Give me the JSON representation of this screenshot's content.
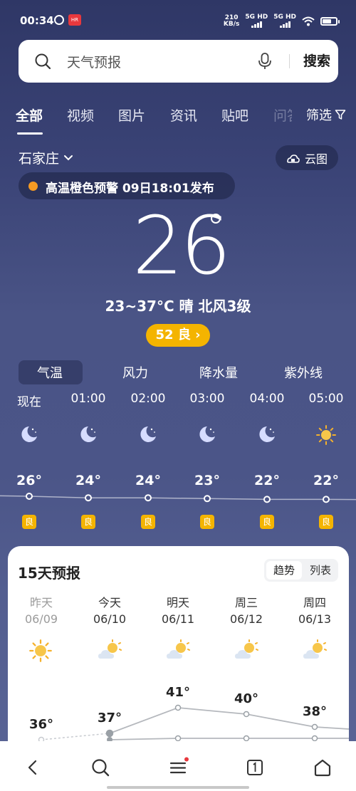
{
  "status_bar": {
    "time": "00:34",
    "app_badge": "HR",
    "net_speed_value": "210",
    "net_speed_unit": "KB/s",
    "sim1": "5G HD",
    "sim2": "5G HD"
  },
  "search": {
    "query": "天气预报",
    "button": "搜索"
  },
  "tabs": [
    "全部",
    "视频",
    "图片",
    "资讯",
    "贴吧",
    "问答"
  ],
  "filter": "筛选",
  "weather": {
    "city": "石家庄",
    "cloud_map": "云图",
    "alert": "高温橙色预警  09日18:01发布",
    "current_temp": "26",
    "description": "23~37°C 晴 北风3级",
    "aqi": "52 良 ›"
  },
  "metric_tabs": [
    "气温",
    "风力",
    "降水量",
    "紫外线"
  ],
  "hourly": [
    {
      "time": "现在",
      "icon": "moon-icon",
      "temp": "26°",
      "aqi": "良",
      "value": 26
    },
    {
      "time": "01:00",
      "icon": "moon-icon",
      "temp": "24°",
      "aqi": "良",
      "value": 24
    },
    {
      "time": "02:00",
      "icon": "moon-icon",
      "temp": "24°",
      "aqi": "良",
      "value": 24
    },
    {
      "time": "03:00",
      "icon": "moon-icon",
      "temp": "23°",
      "aqi": "良",
      "value": 23
    },
    {
      "time": "04:00",
      "icon": "moon-icon",
      "temp": "22°",
      "aqi": "良",
      "value": 22
    },
    {
      "time": "05:00",
      "icon": "sun-icon",
      "temp": "22°",
      "aqi": "良",
      "value": 22
    }
  ],
  "forecast": {
    "title": "15天预报",
    "toggle_trend": "趋势",
    "toggle_list": "列表",
    "days": [
      {
        "name": "昨天",
        "date": "06/09",
        "icon": "sun-icon",
        "high": "36°",
        "high_value": 36,
        "muted": true
      },
      {
        "name": "今天",
        "date": "06/10",
        "icon": "partly-cloudy-icon",
        "high": "37°",
        "high_value": 37,
        "muted": false
      },
      {
        "name": "明天",
        "date": "06/11",
        "icon": "partly-cloudy-icon",
        "high": "41°",
        "high_value": 41,
        "muted": false
      },
      {
        "name": "周三",
        "date": "06/12",
        "icon": "partly-cloudy-icon",
        "high": "40°",
        "high_value": 40,
        "muted": false
      },
      {
        "name": "周四",
        "date": "06/13",
        "icon": "partly-cloudy-icon",
        "high": "38°",
        "high_value": 38,
        "muted": false
      }
    ]
  },
  "colors": {
    "accent_aqi": "#f4b400",
    "alert_dot": "#f59a23",
    "badge_red": "#e8383d"
  }
}
